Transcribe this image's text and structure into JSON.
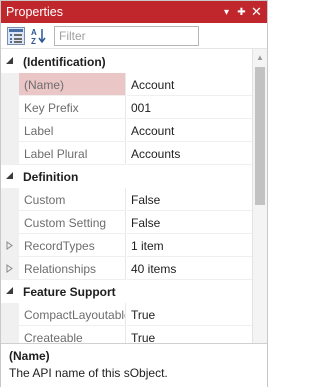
{
  "panel": {
    "title": "Properties",
    "pin_glyph": "▾",
    "dock_glyph": "✚",
    "close_glyph": "✕"
  },
  "toolbar": {
    "categorized_icon": "categorized-view-icon",
    "alphabetical_icon": "alphabetical-sort-icon",
    "filter_placeholder": "Filter",
    "filter_value": ""
  },
  "colors": {
    "titlebar": "#c0272d",
    "selected_name": "#ebc6c7",
    "name_text": "#6d6d6d"
  },
  "groups": [
    {
      "label": "(Identification)",
      "expanded": true,
      "rows": [
        {
          "name": "(Name)",
          "value": "Account",
          "selected": true,
          "expandable": false
        },
        {
          "name": "Key Prefix",
          "value": "001",
          "selected": false,
          "expandable": false
        },
        {
          "name": "Label",
          "value": "Account",
          "selected": false,
          "expandable": false
        },
        {
          "name": "Label Plural",
          "value": "Accounts",
          "selected": false,
          "expandable": false
        }
      ]
    },
    {
      "label": "Definition",
      "expanded": true,
      "rows": [
        {
          "name": "Custom",
          "value": "False",
          "selected": false,
          "expandable": false
        },
        {
          "name": "Custom Setting",
          "value": "False",
          "selected": false,
          "expandable": false
        },
        {
          "name": "RecordTypes",
          "value": "1 item",
          "selected": false,
          "expandable": true
        },
        {
          "name": "Relationships",
          "value": "40 items",
          "selected": false,
          "expandable": true
        }
      ]
    },
    {
      "label": "Feature Support",
      "expanded": true,
      "rows": [
        {
          "name": "CompactLayoutable",
          "value": "True",
          "selected": false,
          "expandable": false
        },
        {
          "name": "Createable",
          "value": "True",
          "selected": false,
          "expandable": false
        }
      ]
    }
  ],
  "description": {
    "title": "(Name)",
    "text": "The API name of this sObject."
  },
  "scrollbar": {
    "up_arrow": "▲",
    "down_arrow": "▼"
  }
}
